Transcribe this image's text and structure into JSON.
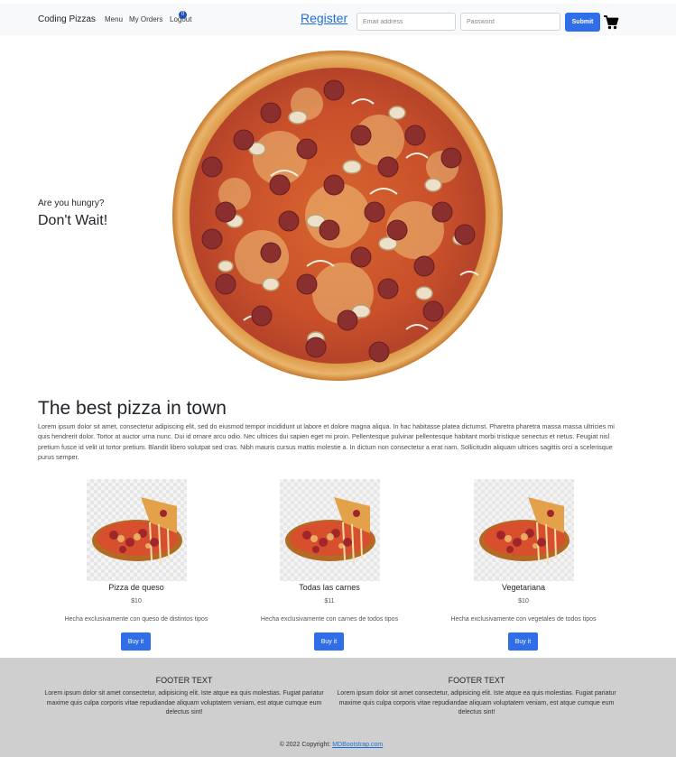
{
  "navbar": {
    "brand": "Coding Pizzas",
    "links": [
      "Menu",
      "My Orders",
      "Logout"
    ],
    "badge_count": "0",
    "register_label": "Register",
    "email_placeholder": "Email address",
    "password_placeholder": "Password",
    "submit_label": "Submit",
    "cart_icon": "shopping-cart-icon"
  },
  "hero": {
    "subtitle": "Are you hungry?",
    "title": "Don't Wait!"
  },
  "section": {
    "title": "The best pizza in town",
    "text": "Lorem ipsum dolor sit amet, consectetur adipiscing elit, sed do eiusmod tempor incididunt ut labore et dolore magna aliqua. In hac habitasse platea dictumst. Pharetra pharetra massa massa ultricies mi quis hendrerit dolor. Tortor at auctor urna nunc. Dui id ornare arcu odio. Nec ultrices dui sapien eget mi proin. Pellentesque pulvinar pellentesque habitant morbi tristique senectus et netus. Feugiat nisl pretium fusce id velit ut tortor pretium. Blandit libero volutpat sed cras. Nibh mauris cursus mattis molestie a. In dictum non consectetur a erat nam. Sollicitudin aliquam ultrices sagittis orci a scelerisque purus semper."
  },
  "products": [
    {
      "name": "Pizza de queso",
      "price": "$10",
      "description": "Hecha exclusivamente con queso de distintos tipos",
      "button": "Buy it"
    },
    {
      "name": "Todas las carnes",
      "price": "$11",
      "description": "Hecha exclusivamente con carnes de todos tipos",
      "button": "Buy it"
    },
    {
      "name": "Vegetariana",
      "price": "$10",
      "description": "Hecha exclusivamente con vegetales de todos tipos",
      "button": "Buy it"
    }
  ],
  "footer": {
    "columns": [
      {
        "title": "FOOTER TEXT",
        "text": "Lorem ipsum dolor sit amet consectetur, adipisicing elit. Iste atque ea quis molestias. Fugiat pariatur maxime quis culpa corporis vitae repudiandae aliquam voluptatem veniam, est atque cumque eum delectus sint!"
      },
      {
        "title": "FOOTER TEXT",
        "text": "Lorem ipsum dolor sit amet consectetur, adipisicing elit. Iste atque ea quis molestias. Fugiat pariatur maxime quis culpa corporis vitae repudiandae aliquam voluptatem veniam, est atque cumque eum delectus sint!"
      }
    ],
    "copyright_prefix": "© 2022 Copyright: ",
    "copyright_link": "MDBootstrap.com"
  },
  "colors": {
    "primary": "#2f6ee8",
    "navbar_bg": "#f8f9fa",
    "footer_bg": "#cfcfcf",
    "link": "#1e6fd9"
  }
}
